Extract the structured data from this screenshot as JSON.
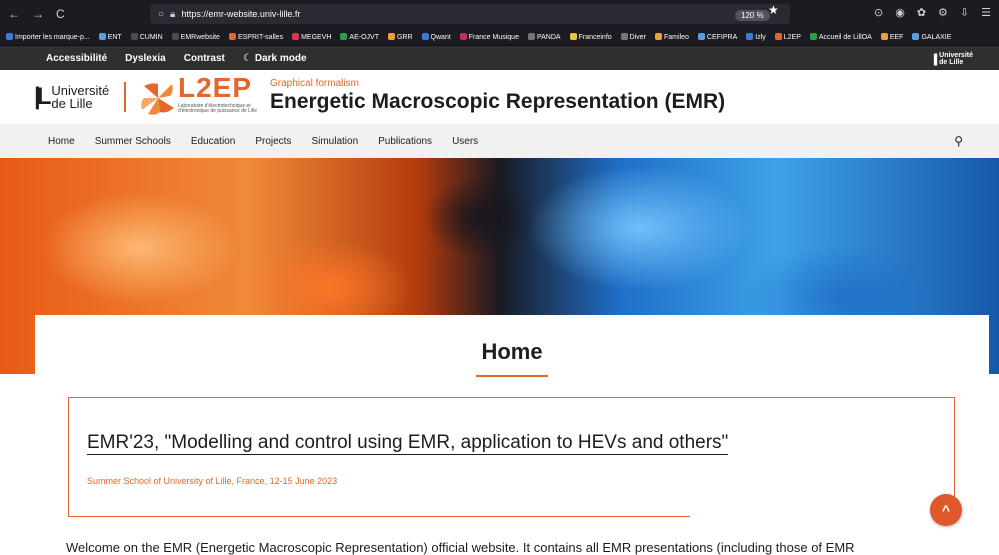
{
  "browser": {
    "nav": [
      "←",
      "→",
      "C"
    ],
    "url": "https://emr-website.univ-lille.fr",
    "zoom": "120 %",
    "star": "★",
    "toolbar_icons": [
      "⊙",
      "◉",
      "✿",
      "⚙",
      "⇩",
      "☰"
    ]
  },
  "bookmarks": [
    {
      "label": "Importer les marque-p...",
      "color": "#3d7bd9"
    },
    {
      "label": "ENT",
      "color": "#5aa0e0"
    },
    {
      "label": "CUMIN",
      "color": "#4c4c4c"
    },
    {
      "label": "EMRwebsite",
      "color": "#4c4c4c"
    },
    {
      "label": "ESPRIT-salles",
      "color": "#e4662a"
    },
    {
      "label": "MEGEVH",
      "color": "#d9364f"
    },
    {
      "label": "AE-OJVT",
      "color": "#2e9d4a"
    },
    {
      "label": "GRR",
      "color": "#e8a13a"
    },
    {
      "label": "Qwant",
      "color": "#3d7bd9"
    },
    {
      "label": "France Musique",
      "color": "#c0305a"
    },
    {
      "label": "PANDA",
      "color": "#777"
    },
    {
      "label": "Franceinfo",
      "color": "#e8c53a"
    },
    {
      "label": "Diver",
      "color": "#777"
    },
    {
      "label": "Famileo",
      "color": "#e8a13a"
    },
    {
      "label": "CEFIPRA",
      "color": "#5aa0e0"
    },
    {
      "label": "Izly",
      "color": "#3d7bd9"
    },
    {
      "label": "L2EP",
      "color": "#e4662a"
    },
    {
      "label": "Accueil de LillOA",
      "color": "#2e9d4a"
    },
    {
      "label": "EEF",
      "color": "#e8a13a"
    },
    {
      "label": "GALAXIE",
      "color": "#5aa0e0"
    }
  ],
  "a11y": {
    "items": [
      "Accessibilité",
      "Dyslexia",
      "Contrast"
    ],
    "dark_mode": "Dark mode",
    "logo_text_1": "Université",
    "logo_text_2": "de Lille"
  },
  "header": {
    "ul_line1": "Université",
    "ul_line2": "de Lille",
    "l2ep_word": "L2EP",
    "l2ep_sub": "Laboratoire d'électrotechnique et d'électronique de puissance de Lille",
    "tagline": "Graphical formalism",
    "title": "Energetic Macroscopic Representation (EMR)"
  },
  "nav": [
    "Home",
    "Summer Schools",
    "Education",
    "Projects",
    "Simulation",
    "Publications",
    "Users"
  ],
  "main": {
    "page_title": "Home",
    "event_title": "EMR'23, \"Modelling and control using EMR, application to HEVs and others\"",
    "event_subtitle": "Summer School of University of Lille, France, 12-15 June 2023",
    "welcome": "Welcome on the EMR (Energetic Macroscopic Representation) official website. It contains all EMR presentations (including those of EMR",
    "scroll_top": "^"
  },
  "colors": {
    "accent": "#e4662a",
    "dark_bar": "#2f2f2f",
    "nav_bg": "#f1f1f1"
  }
}
